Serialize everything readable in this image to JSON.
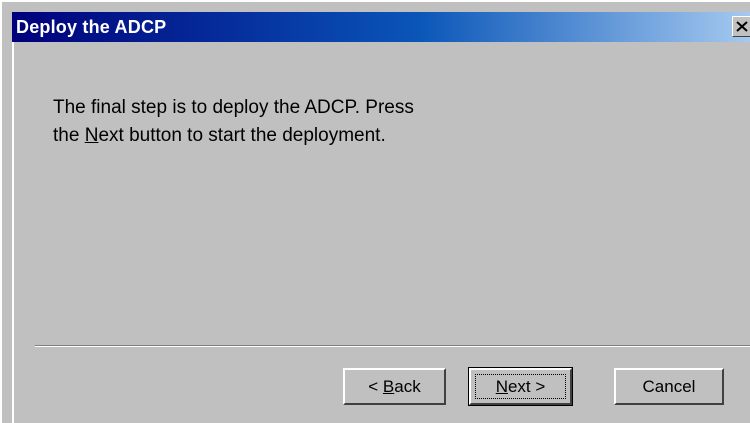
{
  "window": {
    "title": "Deploy the ADCP",
    "close_icon": "close-icon"
  },
  "message": {
    "line1": "The final step is to deploy the ADCP.  Press",
    "line2_prefix": "the ",
    "line2_underlined": "N",
    "line2_after_underline": "ext",
    "line2_suffix": "  button to start the deployment."
  },
  "buttons": {
    "back_prefix": "< ",
    "back_underlined": "B",
    "back_rest": "ack",
    "next_underlined": "N",
    "next_rest": "ext >",
    "cancel_label": "Cancel"
  },
  "colors": {
    "title_gradient_start": "#00007b",
    "title_gradient_end": "#a6caf0",
    "dialog_face": "#c0c0c0"
  }
}
